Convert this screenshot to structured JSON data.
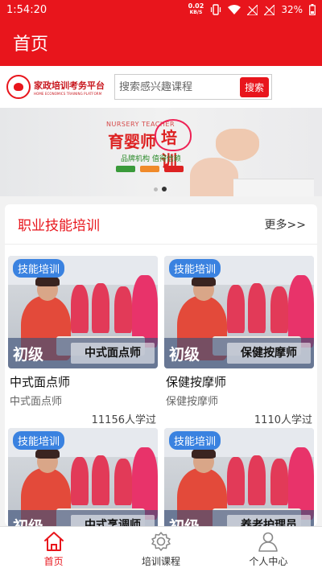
{
  "status_bar": {
    "time": "1:54:20",
    "net_speed": "0.02",
    "net_unit": "KB/S",
    "battery": "32%"
  },
  "title_bar": {
    "title": "首页"
  },
  "search": {
    "logo_text": "家政培训考务平台",
    "logo_subtext": "HOME ECONOMICS TRAINING PLATFORM",
    "placeholder": "搜索感兴趣课程",
    "button_label": "搜索"
  },
  "banner": {
    "en_text": "NURSERY TEACHER",
    "main_text": "育婴师",
    "heart_text": "培训",
    "sub_text": "品牌机构 值得信赖",
    "slide_count": 2,
    "active_slide": 2
  },
  "section": {
    "title": "职业技能培训",
    "more_label": "更多>>",
    "courses": [
      {
        "badge": "技能培训",
        "level": "初级",
        "overlay_name": "中式面点师",
        "title": "中式面点师",
        "subtitle": "中式面点师",
        "count": "11156人学过"
      },
      {
        "badge": "技能培训",
        "level": "初级",
        "overlay_name": "保健按摩师",
        "title": "保健按摩师",
        "subtitle": "保健按摩师",
        "count": "1110人学过"
      },
      {
        "badge": "技能培训",
        "level": "初级",
        "overlay_name": "中式烹调师"
      },
      {
        "badge": "技能培训",
        "level": "初级",
        "overlay_name": "养老护理员"
      }
    ]
  },
  "bottom_nav": {
    "items": [
      {
        "label": "首页",
        "icon": "home-icon",
        "active": true
      },
      {
        "label": "培训课程",
        "icon": "gear-icon",
        "active": false
      },
      {
        "label": "个人中心",
        "icon": "user-icon",
        "active": false
      }
    ]
  },
  "colors": {
    "brand_red": "#e8151c",
    "badge_blue": "#3a82e0"
  }
}
